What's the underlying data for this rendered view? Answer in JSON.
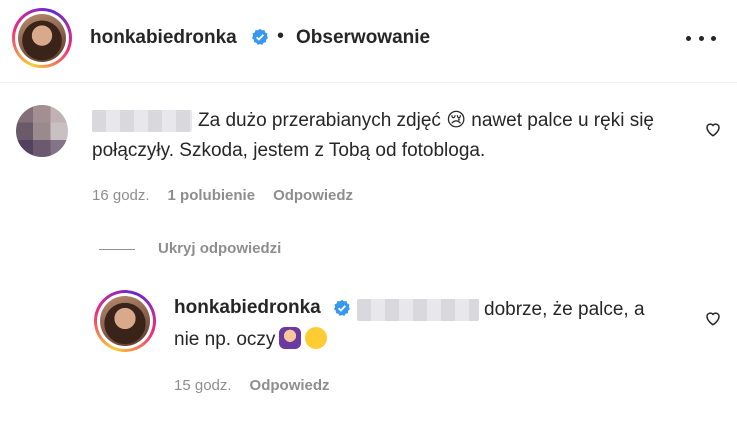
{
  "header": {
    "username": "honkabiedronka",
    "separator": "•",
    "follow_status": "Obserwowanie"
  },
  "comment": {
    "text": "Za dużo przerabianych zdjęć 😢 nawet palce u ręki się połączyły. Szkoda, jestem z Tobą od fotobloga.",
    "time": "16 godz.",
    "likes": "1 polubienie",
    "reply_label": "Odpowiedz"
  },
  "hide_replies_label": "Ukryj odpowiedzi",
  "reply": {
    "username": "honkabiedronka",
    "text": "dobrze, że palce, a nie np. oczy",
    "time": "15 godz.",
    "reply_label": "Odpowiedz"
  },
  "colors": {
    "verified": "#3897f0",
    "muted": "#8e8e8e",
    "text": "#262626"
  }
}
